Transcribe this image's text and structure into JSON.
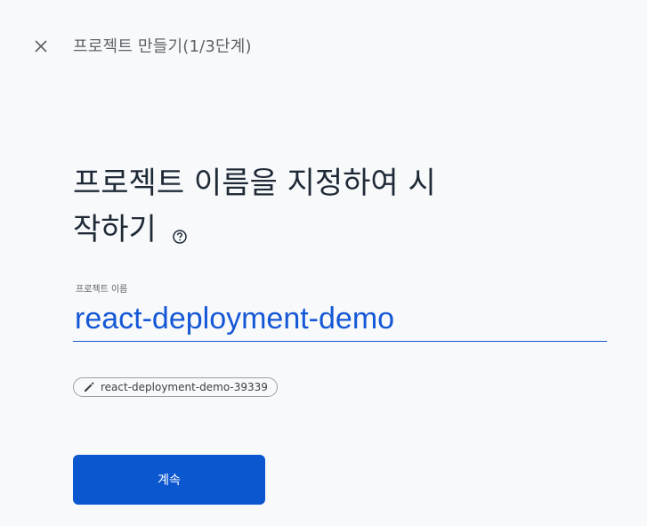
{
  "header": {
    "close_icon": "close-icon",
    "title": "프로젝트 만들기(1/3단계)"
  },
  "main": {
    "headline_line1": "프로젝트 이름을 지정하여 시",
    "headline_line2": "작하기",
    "help_icon": "help-circle-icon",
    "field_label": "프로젝트 이름",
    "project_name_value": "react-deployment-demo",
    "project_id_chip": "react-deployment-demo-39339",
    "chip_icon": "pencil-icon",
    "continue_label": "계속"
  },
  "colors": {
    "accent": "#0b57d0",
    "input_text": "#1558d6",
    "background": "#f8f9fb"
  }
}
